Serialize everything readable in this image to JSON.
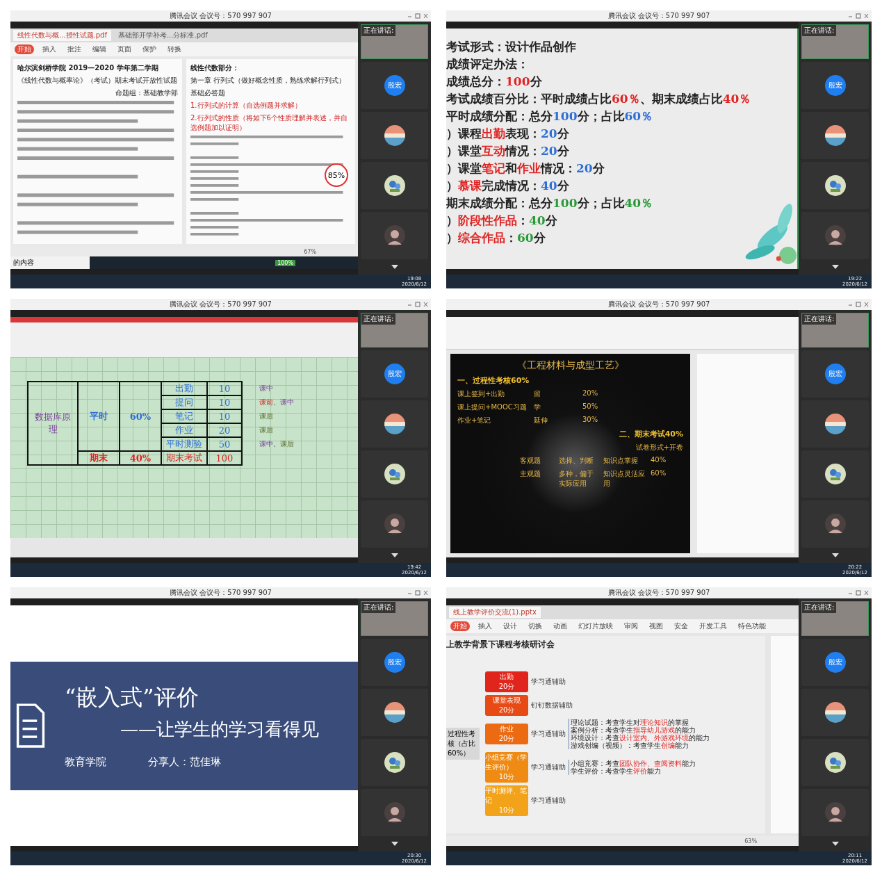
{
  "panels": [
    {
      "window_title": "腾讯会议 会议号：570 997 907",
      "kind": "pdf_document",
      "speaker_label": "正在讲话:",
      "participants": [
        {
          "kind": "initials",
          "name": "殷宏"
        },
        {
          "kind": "landscape"
        },
        {
          "kind": "flower"
        },
        {
          "kind": "portrait"
        }
      ],
      "clock": {
        "time": "19:08",
        "date": "2020/6/12"
      },
      "content": {
        "tabs": [
          {
            "label": "线性代数与概...授性试题.pdf",
            "selected": true
          },
          {
            "label": "基础部开学补考...分标准.pdf",
            "selected": false
          }
        ],
        "ribbon": [
          {
            "label": "开始",
            "selected": true
          },
          {
            "label": "插入",
            "selected": false
          },
          {
            "label": "批注",
            "selected": false
          },
          {
            "label": "编辑",
            "selected": false
          },
          {
            "label": "页面",
            "selected": false
          },
          {
            "label": "保护",
            "selected": false
          },
          {
            "label": "转换",
            "selected": false
          }
        ],
        "left_lines": [
          {
            "text": "哈尔滨剑桥学院 2019—2020 学年第二学期",
            "kind": "heading"
          },
          {
            "text": "《线性代数与概率论》（考试）期末考试开放性试题",
            "kind": "line"
          },
          {
            "text": "命题组：基础教学部",
            "kind": "right"
          }
        ],
        "right_lines": [
          {
            "text": "线性代数部分：",
            "kind": "heading"
          },
          {
            "text": "第一章 行列式（做好概念性质，熟练求解行列式）",
            "kind": "line"
          },
          {
            "text": "基础必答题",
            "kind": "line"
          },
          {
            "text": "1.行列式的计算（自选例题并求解）",
            "kind": "note"
          },
          {
            "text": "2.行列式的性质（将如下6个性质理解并表述，并自选例题加以证明）",
            "kind": "note"
          }
        ],
        "zoom_badge": "85%",
        "zoom_level": "67%",
        "search_text": "的内容",
        "battery": "100%"
      }
    },
    {
      "window_title": "腾讯会议 会议号：570 997 907",
      "kind": "text_slide",
      "speaker_label": "正在讲话:",
      "participants": [
        {
          "kind": "initials",
          "name": "殷宏"
        },
        {
          "kind": "landscape"
        },
        {
          "kind": "flower"
        },
        {
          "kind": "portrait"
        }
      ],
      "clock": {
        "time": "19:22",
        "date": "2020/6/12"
      },
      "content": {
        "lines": [
          [
            {
              "text": "考试形式：设计作品创作",
              "kind": "plain"
            }
          ],
          [
            {
              "text": "成绩评定办法：",
              "kind": "plain"
            }
          ],
          [
            {
              "text": "成绩总分：",
              "kind": "plain"
            },
            {
              "text": "100",
              "kind": "red"
            },
            {
              "text": "分",
              "kind": "plain"
            }
          ],
          [
            {
              "text": "考试成绩百分比：平时成绩占比",
              "kind": "plain"
            },
            {
              "text": "60％",
              "kind": "red"
            },
            {
              "text": "、期末成绩占比",
              "kind": "plain"
            },
            {
              "text": "40％",
              "kind": "red"
            }
          ],
          [
            {
              "text": "平时成绩分配：总分",
              "kind": "plain"
            },
            {
              "text": "100",
              "kind": "blue"
            },
            {
              "text": "分；占比",
              "kind": "plain"
            },
            {
              "text": "60％",
              "kind": "blue"
            }
          ],
          [
            {
              "text": "）课程",
              "kind": "plain"
            },
            {
              "text": "出勤",
              "kind": "red"
            },
            {
              "text": "表现：",
              "kind": "plain"
            },
            {
              "text": "20",
              "kind": "blue"
            },
            {
              "text": "分",
              "kind": "plain"
            }
          ],
          [
            {
              "text": "）课堂",
              "kind": "plain"
            },
            {
              "text": "互动",
              "kind": "red"
            },
            {
              "text": "情况：",
              "kind": "plain"
            },
            {
              "text": "20",
              "kind": "blue"
            },
            {
              "text": "分",
              "kind": "plain"
            }
          ],
          [
            {
              "text": "）课堂",
              "kind": "plain"
            },
            {
              "text": "笔记",
              "kind": "red"
            },
            {
              "text": "和",
              "kind": "plain"
            },
            {
              "text": "作业",
              "kind": "red"
            },
            {
              "text": "情况：",
              "kind": "plain"
            },
            {
              "text": "20",
              "kind": "blue"
            },
            {
              "text": "分",
              "kind": "plain"
            }
          ],
          [
            {
              "text": "）",
              "kind": "plain"
            },
            {
              "text": "慕课",
              "kind": "red"
            },
            {
              "text": "完成情况：",
              "kind": "plain"
            },
            {
              "text": "40",
              "kind": "blue"
            },
            {
              "text": "分",
              "kind": "plain"
            }
          ],
          [
            {
              "text": "期末成绩分配：总分",
              "kind": "plain"
            },
            {
              "text": "100",
              "kind": "green"
            },
            {
              "text": "分；占比",
              "kind": "plain"
            },
            {
              "text": "40％",
              "kind": "green"
            }
          ],
          [
            {
              "text": "）",
              "kind": "plain"
            },
            {
              "text": "阶段性作品",
              "kind": "red"
            },
            {
              "text": "：",
              "kind": "plain"
            },
            {
              "text": "40",
              "kind": "green"
            },
            {
              "text": "分",
              "kind": "plain"
            }
          ],
          [
            {
              "text": "）",
              "kind": "plain"
            },
            {
              "text": "综合作品",
              "kind": "red"
            },
            {
              "text": "：",
              "kind": "plain"
            },
            {
              "text": "60",
              "kind": "green"
            },
            {
              "text": "分",
              "kind": "plain"
            }
          ]
        ]
      }
    },
    {
      "window_title": "腾讯会议 会议号：570 997 907",
      "kind": "spreadsheet",
      "speaker_label": "正在讲话:",
      "participants": [
        {
          "kind": "initials",
          "name": "殷宏"
        },
        {
          "kind": "landscape"
        },
        {
          "kind": "flower"
        },
        {
          "kind": "portrait"
        }
      ],
      "clock": {
        "time": "19:42",
        "date": "2020/6/12"
      },
      "content": {
        "course": "数据库原理",
        "groups": [
          {
            "name": "平时",
            "share": "60%",
            "kind": "blue",
            "items": [
              {
                "name": "出勤",
                "score": "10",
                "notes": [
                  {
                    "text": "课中",
                    "kind": "purple"
                  }
                ]
              },
              {
                "name": "提问",
                "score": "10",
                "notes": [
                  {
                    "text": "课前",
                    "kind": "red"
                  },
                  {
                    "text": "、",
                    "kind": "plain"
                  },
                  {
                    "text": "课中",
                    "kind": "purple"
                  }
                ]
              },
              {
                "name": "笔记",
                "score": "10",
                "notes": [
                  {
                    "text": "课后",
                    "kind": "olive"
                  }
                ]
              },
              {
                "name": "作业",
                "score": "20",
                "notes": [
                  {
                    "text": "课后",
                    "kind": "olive"
                  }
                ]
              },
              {
                "name": "平时测验",
                "score": "50",
                "notes": [
                  {
                    "text": "课中",
                    "kind": "purple"
                  },
                  {
                    "text": "、",
                    "kind": "plain"
                  },
                  {
                    "text": "课后",
                    "kind": "olive"
                  }
                ]
              }
            ]
          },
          {
            "name": "期末",
            "share": "40%",
            "kind": "red",
            "items": [
              {
                "name": "期末考试",
                "score": "100"
              }
            ]
          }
        ]
      }
    },
    {
      "window_title": "腾讯会议 会议号：570 997 907",
      "kind": "dark_slide",
      "speaker_label": "正在讲话:",
      "participants": [
        {
          "kind": "initials",
          "name": "殷宏"
        },
        {
          "kind": "landscape"
        },
        {
          "kind": "flower"
        },
        {
          "kind": "portrait"
        }
      ],
      "clock": {
        "time": "20:22",
        "date": "2020/6/12"
      },
      "content": {
        "title": "《工程材料与成型工艺》",
        "section_1": "一、过程性考核60%",
        "rows_1": [
          [
            "课上签到+出勤",
            "留",
            "20%"
          ],
          [
            "课上提问+MOOC习题",
            "学",
            "50%"
          ],
          [
            "作业+笔记",
            "延伸",
            "30%"
          ]
        ],
        "section_2": "二、期末考试40%",
        "subtitle": "试卷形式+开卷",
        "rows_2": [
          [
            "客观题",
            "选择、判断",
            "知识点掌握",
            "40%"
          ],
          [
            "主观题",
            "多种，偏于实际应用",
            "知识点灵活应用",
            "60%"
          ]
        ]
      }
    },
    {
      "window_title": "腾讯会议 会议号：570 997 907",
      "kind": "title_slide",
      "speaker_label": "正在讲话:",
      "participants": [
        {
          "kind": "initials",
          "name": "殷宏"
        },
        {
          "kind": "landscape"
        },
        {
          "kind": "flower"
        },
        {
          "kind": "portrait"
        }
      ],
      "clock": {
        "time": "20:30",
        "date": "2020/6/12"
      },
      "content": {
        "title": "“嵌入式”评价",
        "subtitle": "——让学生的学习看得见",
        "college": "教育学院",
        "presenter": "分享人：范佳琳"
      }
    },
    {
      "window_title": "腾讯会议 会议号：570 997 907",
      "kind": "mindmap_slide",
      "speaker_label": "正在讲话:",
      "participants": [
        {
          "kind": "initials",
          "name": "殷宏"
        },
        {
          "kind": "landscape"
        },
        {
          "kind": "flower"
        },
        {
          "kind": "portrait"
        }
      ],
      "clock": {
        "time": "20:11",
        "date": "2020/6/12"
      },
      "content": {
        "file_tab": "线上教学评价交流(1).pptx",
        "ribbon": [
          {
            "label": "开始",
            "selected": true
          },
          {
            "label": "插入",
            "selected": false
          },
          {
            "label": "设计",
            "selected": false
          },
          {
            "label": "切换",
            "selected": false
          },
          {
            "label": "动画",
            "selected": false
          },
          {
            "label": "幻灯片放映",
            "selected": false
          },
          {
            "label": "审阅",
            "selected": false
          },
          {
            "label": "视图",
            "selected": false
          },
          {
            "label": "安全",
            "selected": false
          },
          {
            "label": "开发工具",
            "selected": false
          },
          {
            "label": "特色功能",
            "selected": false
          }
        ],
        "title": "上教学背景下课程考核研讨会",
        "root": "过程性考核（占比60%）",
        "zoom_level": "63%",
        "items": [
          {
            "label": "出勤",
            "score": "20分",
            "color": "#e0261c",
            "aid": "学习通辅助"
          },
          {
            "label": "课堂表现",
            "score": "20分",
            "color": "#e84a16",
            "aid": "钉钉数据辅助"
          },
          {
            "label": "作业",
            "score": "20分",
            "color": "#eb6a12",
            "aid": "学习通辅助",
            "details": [
              [
                {
                  "text": "理论试题：考查学生对",
                  "kind": "plain"
                },
                {
                  "text": "理论知识",
                  "kind": "red"
                },
                {
                  "text": "的掌握",
                  "kind": "plain"
                }
              ],
              [
                {
                  "text": "案例分析：考查学生",
                  "kind": "plain"
                },
                {
                  "text": "指导幼儿游戏",
                  "kind": "red"
                },
                {
                  "text": "的能力",
                  "kind": "plain"
                }
              ],
              [
                {
                  "text": "环境设计：考查",
                  "kind": "plain"
                },
                {
                  "text": "设计室内、外游戏环境",
                  "kind": "red"
                },
                {
                  "text": "的能力",
                  "kind": "plain"
                }
              ],
              [
                {
                  "text": "游戏创编（视频）：考查学生",
                  "kind": "plain"
                },
                {
                  "text": "创编",
                  "kind": "red"
                },
                {
                  "text": "能力",
                  "kind": "plain"
                }
              ]
            ]
          },
          {
            "label": "小组竞赛（学生评价）",
            "score": "10分",
            "color": "#ef8a12",
            "aid": "学习通辅助",
            "details": [
              [
                {
                  "text": "小组竞赛：考查",
                  "kind": "plain"
                },
                {
                  "text": "团队协作、查阅资料",
                  "kind": "red"
                },
                {
                  "text": "能力",
                  "kind": "plain"
                }
              ],
              [
                {
                  "text": "学生评价：考查学生",
                  "kind": "plain"
                },
                {
                  "text": "评价",
                  "kind": "red"
                },
                {
                  "text": "能力",
                  "kind": "plain"
                }
              ]
            ]
          },
          {
            "label": "平时测评、笔记",
            "score": "10分",
            "color": "#f2a31a",
            "aid": "学习通辅助"
          }
        ]
      }
    }
  ]
}
